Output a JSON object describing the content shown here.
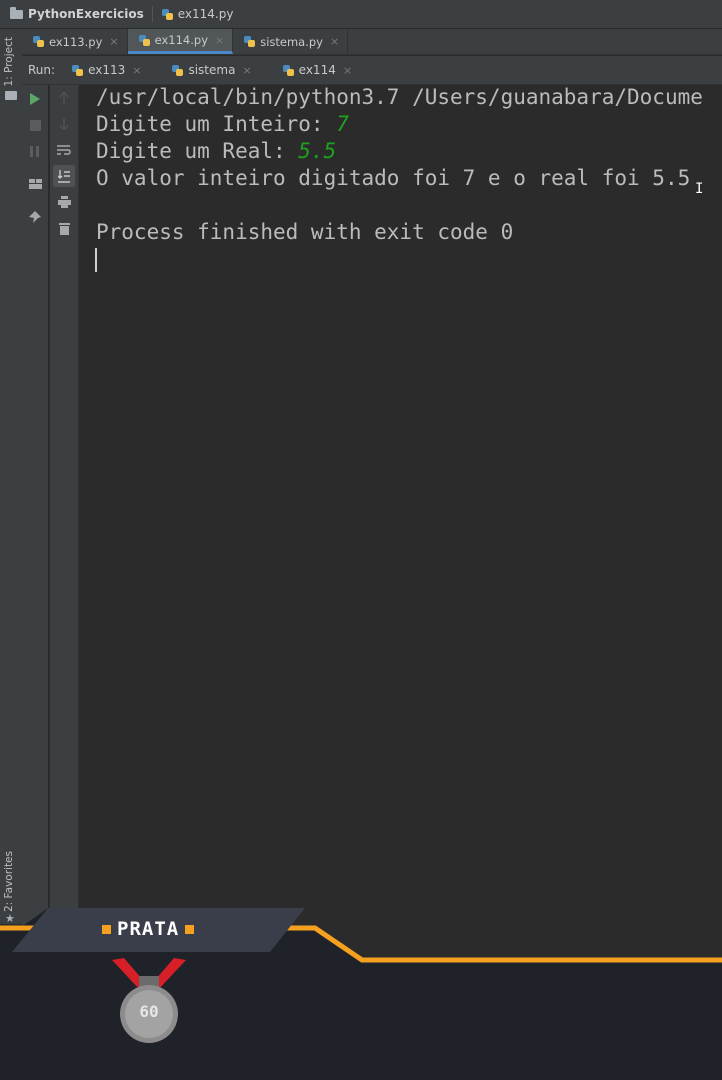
{
  "breadcrumb": {
    "project": "PythonExercicios",
    "file": "ex114.py"
  },
  "editor_tabs": [
    {
      "label": "ex113.py",
      "close": "×"
    },
    {
      "label": "ex114.py",
      "close": "×"
    },
    {
      "label": "sistema.py",
      "close": "×"
    }
  ],
  "left_strip": {
    "project": "1: Project",
    "favorites": "2: Favorites"
  },
  "run": {
    "label": "Run:",
    "tabs": [
      {
        "label": "ex113",
        "close": "×"
      },
      {
        "label": "sistema",
        "close": "×"
      },
      {
        "label": "ex114",
        "close": "×"
      }
    ]
  },
  "console": {
    "command": "/usr/local/bin/python3.7 /Users/guanabara/Docume",
    "prompt_int": "Digite um Inteiro: ",
    "input_int": "7",
    "prompt_real": "Digite um Real: ",
    "input_real": "5.5",
    "result": "O valor inteiro digitado foi 7 e o real foi 5.5",
    "finished": "Process finished with exit code 0"
  },
  "overlay": {
    "rank": "PRATA",
    "medal_number": "60"
  },
  "colors": {
    "accent_orange": "#f5a01f",
    "input_green": "#1ea11e",
    "tab_underline": "#4a88c7"
  }
}
